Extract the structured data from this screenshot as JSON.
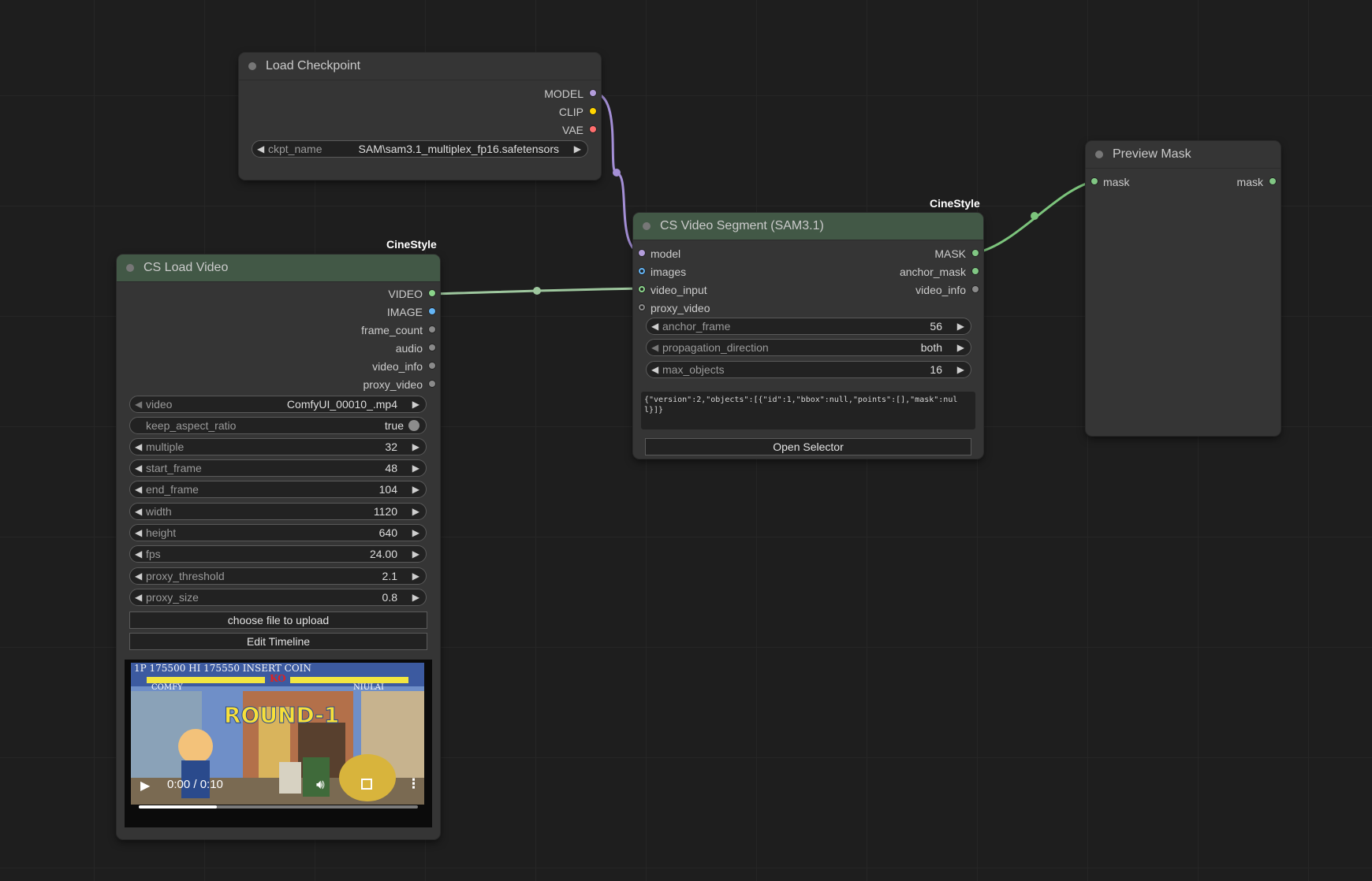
{
  "colors": {
    "model": "#b39ddb",
    "clip": "#ffd500",
    "vae": "#ff6e6e",
    "image": "#64b5f6",
    "video": "#8bd58b",
    "mask": "#81c784",
    "neutral": "#8a8a8a",
    "wire_model": "#a48fd6",
    "wire_video": "#9ec79e",
    "wire_mask": "#7cc47c"
  },
  "load_checkpoint": {
    "title": "Load Checkpoint",
    "outputs": [
      "MODEL",
      "CLIP",
      "VAE"
    ],
    "ckpt_label": "ckpt_name",
    "ckpt_value": "SAM\\sam3.1_multiplex_fp16.safetensors"
  },
  "cs_load_video": {
    "badge": "CineStyle",
    "title": "CS Load Video",
    "outputs": [
      "VIDEO",
      "IMAGE",
      "frame_count",
      "audio",
      "video_info",
      "proxy_video"
    ],
    "widgets": [
      {
        "label": "video",
        "value": "ComfyUI_00010_.mp4"
      },
      {
        "label": "keep_aspect_ratio",
        "value": "true"
      },
      {
        "label": "multiple",
        "value": "32"
      },
      {
        "label": "start_frame",
        "value": "48"
      },
      {
        "label": "end_frame",
        "value": "104"
      },
      {
        "label": "width",
        "value": "1120"
      },
      {
        "label": "height",
        "value": "640"
      },
      {
        "label": "fps",
        "value": "24.00"
      },
      {
        "label": "proxy_threshold",
        "value": "2.1"
      },
      {
        "label": "proxy_size",
        "value": "0.8"
      }
    ],
    "upload_button": "choose file to upload",
    "timeline_button": "Edit Timeline",
    "video_time": "0:00 / 0:10",
    "video_progress": 0.28,
    "video_texts": {
      "hud_top": "1P 175500   HI 175550  INSERT COIN",
      "ko": "KO",
      "p1": "COMFY",
      "p2": "NIULAI",
      "round": "ROUND-1"
    }
  },
  "cs_video_segment": {
    "badge": "CineStyle",
    "title": "CS Video Segment (SAM3.1)",
    "inputs": [
      "model",
      "images",
      "video_input",
      "proxy_video"
    ],
    "outputs": [
      "MASK",
      "anchor_mask",
      "video_info"
    ],
    "widgets": [
      {
        "label": "anchor_frame",
        "value": "56"
      },
      {
        "label": "propagation_direction",
        "value": "both"
      },
      {
        "label": "max_objects",
        "value": "16"
      }
    ],
    "json_text": "{\"version\":2,\"objects\":[{\"id\":1,\"bbox\":null,\"points\":[],\"mask\":null}]}",
    "selector_button": "Open Selector"
  },
  "preview_mask": {
    "title": "Preview Mask",
    "input": "mask",
    "output": "mask"
  }
}
